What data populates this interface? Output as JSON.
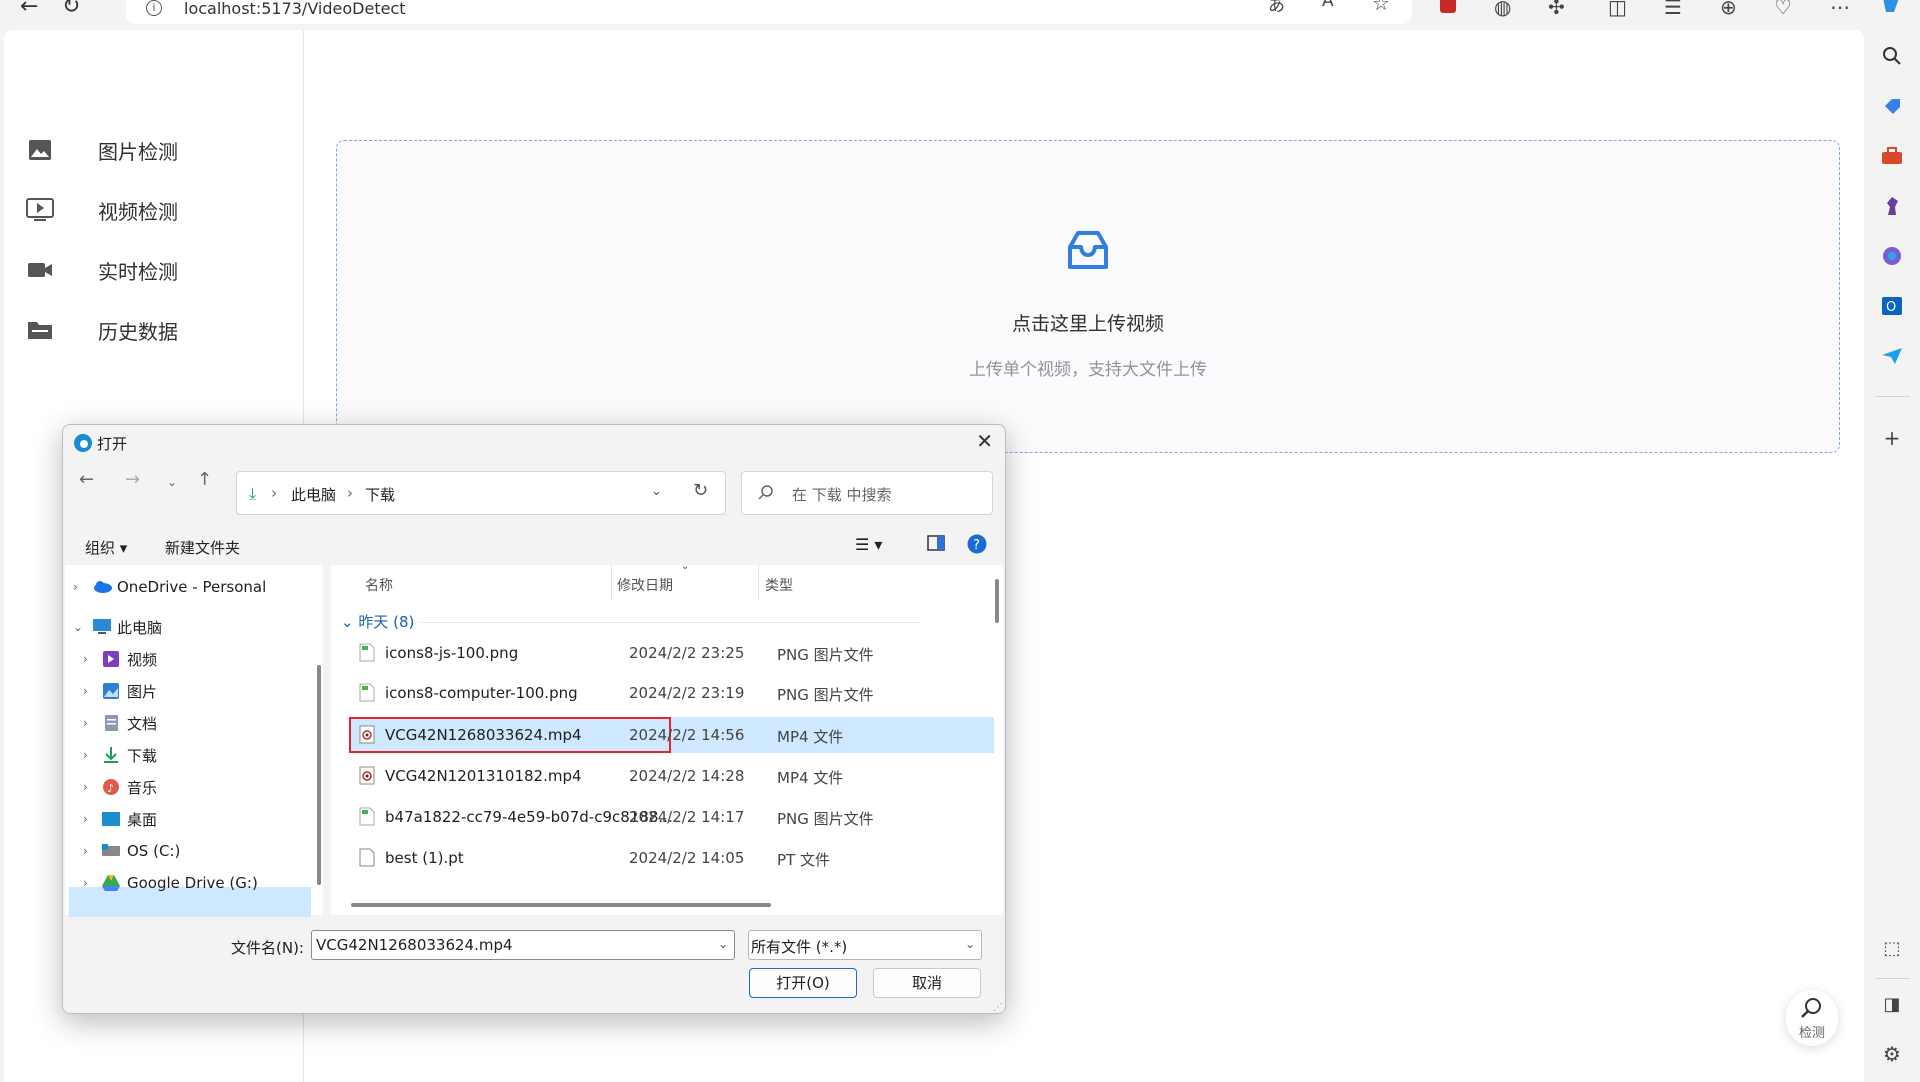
{
  "browser": {
    "url": "localhost:5173/VideoDetect"
  },
  "leftnav": {
    "items": [
      {
        "label": "图片检测",
        "icon": "image-icon"
      },
      {
        "label": "视频检测",
        "icon": "video-icon"
      },
      {
        "label": "实时检测",
        "icon": "camera-icon"
      },
      {
        "label": "历史数据",
        "icon": "folder-icon"
      }
    ]
  },
  "upload": {
    "title": "点击这里上传视频",
    "hint": "上传单个视频，支持大文件上传"
  },
  "detect_fab": {
    "label": "检测"
  },
  "dialog": {
    "title": "打开",
    "path": [
      "此电脑",
      "下载"
    ],
    "search_placeholder": "在 下载 中搜索",
    "organize": "组织 ▾",
    "new_folder": "新建文件夹",
    "tree": [
      {
        "label": "OneDrive - Personal",
        "icon": "cloud-icon",
        "color": "#1a73e8"
      },
      {
        "label": "此电脑",
        "icon": "computer-icon",
        "color": "#2a8ad4"
      },
      {
        "label": "视频",
        "icon": "video-folder-icon",
        "color": "#7b3fbf"
      },
      {
        "label": "图片",
        "icon": "pictures-folder-icon",
        "color": "#2f7fd6"
      },
      {
        "label": "文档",
        "icon": "documents-folder-icon",
        "color": "#7a8aa0"
      },
      {
        "label": "下载",
        "icon": "download-folder-icon",
        "color": "#1e9e5a"
      },
      {
        "label": "音乐",
        "icon": "music-folder-icon",
        "color": "#e05a4a"
      },
      {
        "label": "桌面",
        "icon": "desktop-folder-icon",
        "color": "#1d8fd0"
      },
      {
        "label": "OS (C:)",
        "icon": "drive-icon",
        "color": "#555555"
      },
      {
        "label": "Google Drive (G:)",
        "icon": "google-drive-icon",
        "color": "#34a853"
      }
    ],
    "columns": {
      "name": "名称",
      "date": "修改日期",
      "type": "类型"
    },
    "group": "昨天 (8)",
    "files": [
      {
        "name": "icons8-js-100.png",
        "date": "2024/2/2 23:25",
        "type": "PNG 图片文件",
        "icon": "png-file-icon"
      },
      {
        "name": "icons8-computer-100.png",
        "date": "2024/2/2 23:19",
        "type": "PNG 图片文件",
        "icon": "png-file-icon"
      },
      {
        "name": "VCG42N1268033624.mp4",
        "date": "2024/2/2 14:56",
        "type": "MP4 文件",
        "icon": "mp4-file-icon"
      },
      {
        "name": "VCG42N1201310182.mp4",
        "date": "2024/2/2 14:28",
        "type": "MP4 文件",
        "icon": "mp4-file-icon"
      },
      {
        "name": "b47a1822-cc79-4e59-b07d-c9c8188...",
        "date": "2024/2/2 14:17",
        "type": "PNG 图片文件",
        "icon": "png-file-icon"
      },
      {
        "name": "best (1).pt",
        "date": "2024/2/2 14:05",
        "type": "PT 文件",
        "icon": "blank-file-icon"
      }
    ],
    "filename_label": "文件名(N):",
    "filename_value": "VCG42N1268033624.mp4",
    "filetype_value": "所有文件 (*.*)",
    "open_label": "打开(O)",
    "cancel_label": "取消"
  }
}
